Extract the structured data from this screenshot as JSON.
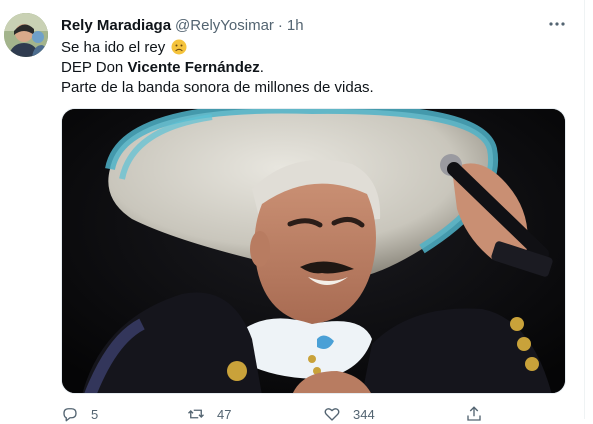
{
  "tweet": {
    "display_name": "Rely Maradiaga",
    "handle": "@RelyYosimar",
    "separator": "·",
    "time": "1h",
    "text_line1": "Se ha ido el rey",
    "text_line1_emoji": "slightly-frowning-face-icon",
    "text_line2_prefix": "DEP Don ",
    "text_line2_bold": "Vicente Fernández",
    "text_line2_suffix": ".",
    "text_line3": "Parte de la banda sonora de millones de vidas."
  },
  "media": {
    "description_icon": "photo"
  },
  "actions": {
    "replies": "5",
    "retweets": "47",
    "likes": "344"
  },
  "colors": {
    "text": "#0f1419",
    "muted": "#536471",
    "divider": "#eff3f4",
    "emoji": "#f5c33b"
  }
}
